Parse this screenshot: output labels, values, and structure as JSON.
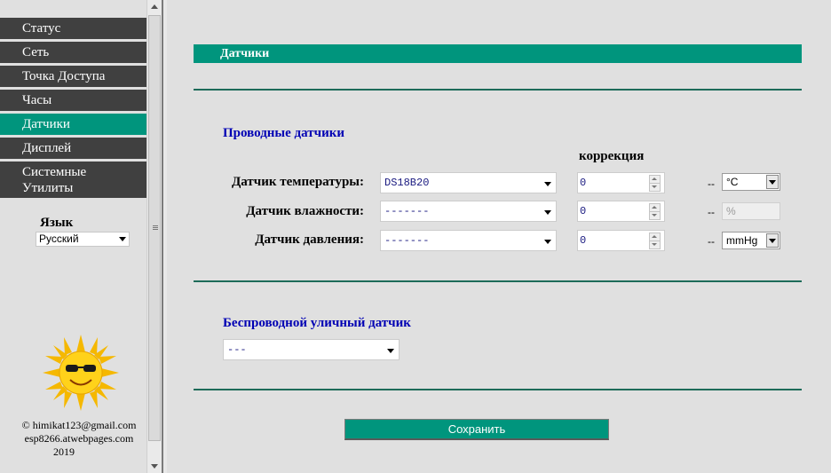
{
  "sidebar": {
    "items": [
      {
        "label": "Статус"
      },
      {
        "label": "Сеть"
      },
      {
        "label": "Точка Доступа"
      },
      {
        "label": "Часы"
      },
      {
        "label": "Датчики",
        "active": true
      },
      {
        "label": "Дисплей"
      },
      {
        "label": "Системные",
        "label2": "Утилиты"
      }
    ],
    "language_label": "Язык",
    "language_value": "Русский",
    "footer_email": "© himikat123@gmail.com",
    "footer_site": "esp8266.atwebpages.com",
    "footer_year": "2019"
  },
  "main": {
    "title": "Датчики",
    "wired_title": "Проводные датчики",
    "correction_header": "коррекция",
    "sensors": [
      {
        "label": "Датчик температуры:",
        "value": "DS18B20",
        "correction": "0",
        "dash": "--",
        "unit": "°C",
        "unit_enabled": true
      },
      {
        "label": "Датчик влажности:",
        "value": "-------",
        "correction": "0",
        "dash": "--",
        "unit": "%",
        "unit_enabled": false
      },
      {
        "label": "Датчик давления:",
        "value": "-------",
        "correction": "0",
        "dash": "--",
        "unit": "mmHg",
        "unit_enabled": true
      }
    ],
    "wireless_title": "Беспроводной уличный датчик",
    "wireless_value": "---",
    "save_label": "Сохранить"
  },
  "colors": {
    "accent": "#00957d",
    "menu_bg": "#404040",
    "heading_blue": "#0000b4",
    "page_bg": "#e0e0e0"
  }
}
